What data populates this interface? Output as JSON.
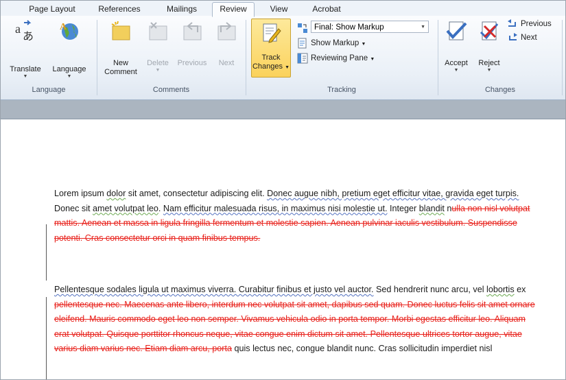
{
  "tabs": [
    {
      "label": "Page Layout"
    },
    {
      "label": "References"
    },
    {
      "label": "Mailings"
    },
    {
      "label": "Review",
      "active": true
    },
    {
      "label": "View"
    },
    {
      "label": "Acrobat"
    }
  ],
  "groups": {
    "language": {
      "label": "Language",
      "translate": "Translate",
      "language": "Language"
    },
    "comments": {
      "label": "Comments",
      "new_comment_1": "New",
      "new_comment_2": "Comment",
      "delete": "Delete",
      "previous": "Previous",
      "next": "Next"
    },
    "tracking": {
      "label": "Tracking",
      "track_changes_1": "Track",
      "track_changes_2": "Changes",
      "display_select": "Final: Show Markup",
      "show_markup": "Show Markup",
      "reviewing_pane": "Reviewing Pane"
    },
    "changes": {
      "label": "Changes",
      "accept": "Accept",
      "reject": "Reject",
      "previous": "Previous",
      "next": "Next"
    }
  },
  "icons": {
    "translate": "translate-icon",
    "language": "language-globe-icon",
    "new_comment": "new-comment-icon",
    "track_changes": "track-changes-icon",
    "accept": "accept-check-icon",
    "reject": "reject-x-icon"
  },
  "colors": {
    "deleted_text": "#e8201a",
    "track_changes_active": "#fbd968",
    "ribbon_bg": "#eaf0f7"
  },
  "document": {
    "p1": {
      "a": "Lorem ipsum ",
      "b": "dolor",
      "c": " sit amet, consectetur adipiscing elit. ",
      "d": "Donec augue nibh, pretium eget efficitur vitae, gravida eget turpis.",
      "e": " Donec sit ",
      "f": "amet volutpat leo",
      "g": ". ",
      "h": "Nam efficitur malesuada risus, in maximus nisi molestie ut.",
      "i": " Integer ",
      "j": "blandit",
      "k": " n",
      "deleted": "ulla non nisl volutpat mattis. Aenean et massa in ligula fringilla fermentum et molestie sapien. Aenean pulvinar iaculis vestibulum. Suspendisse potenti. Cras consectetur orci in quam finibus tempus."
    },
    "p2": {
      "a": "Pellentesque sodales ligula ut maximus viverra. Curabitur finibus et justo vel auctor.",
      "b": " Sed hendrerit nunc arcu, vel ",
      "c": "lobortis",
      "d": " ex ",
      "deleted": "pellentesque nec. Maecenas ante libero, interdum nec volutpat sit amet, dapibus sed quam. Donec luctus felis sit amet ornare eleifend. Mauris commodo eget leo non semper. Vivamus vehicula odio in porta tempor. Morbi egestas efficitur leo. Aliquam erat volutpat. Quisque porttitor rhoncus neque, vitae congue enim dictum sit amet. Pellentesque ultrices tortor augue, vitae varius diam varius nec. Etiam diam arcu, porta",
      "e": " quis lectus nec, congue blandit nunc. Cras sollicitudin imperdiet nisl"
    }
  }
}
